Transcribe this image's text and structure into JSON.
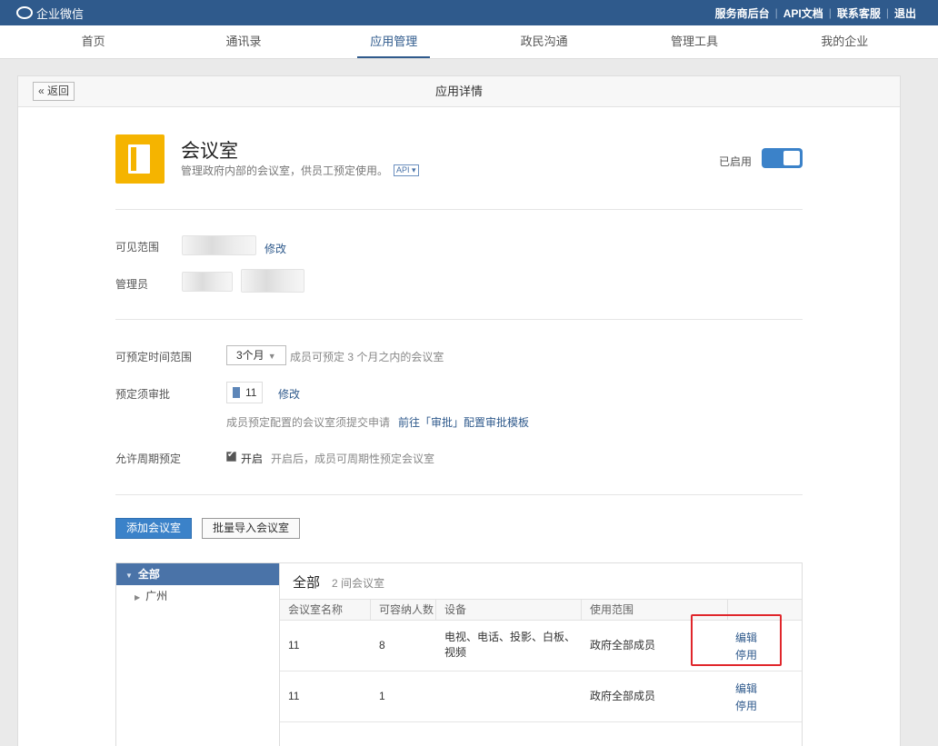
{
  "topbar": {
    "brand": "企业微信",
    "links": [
      "服务商后台",
      "API文档",
      "联系客服",
      "退出"
    ]
  },
  "nav": {
    "items": [
      "首页",
      "通讯录",
      "应用管理",
      "政民沟通",
      "管理工具",
      "我的企业"
    ],
    "active_index": 2
  },
  "card": {
    "title": "应用详情",
    "back_label": "« 返回"
  },
  "app": {
    "name": "会议室",
    "description": "管理政府内部的会议室，供员工预定使用。",
    "api_tag": "API ▾",
    "status_label": "已启用",
    "enabled": true
  },
  "visibility": {
    "label": "可见范围",
    "edit": "修改"
  },
  "admins": {
    "label": "管理员"
  },
  "booking_range": {
    "label": "可预定时间范围",
    "selected": "3个月",
    "hint": "成员可预定 3 个月之内的会议室"
  },
  "approval": {
    "label": "预定须审批",
    "approver": "11",
    "edit": "修改",
    "hint": "成员预定配置的会议室须提交申请",
    "link": "前往「审批」配置审批模板"
  },
  "recurring": {
    "label": "允许周期预定",
    "checked": true,
    "option": "开启",
    "hint": "开启后，成员可周期性预定会议室"
  },
  "actions": {
    "add": "添加会议室",
    "import": "批量导入会议室"
  },
  "tree": {
    "root": "全部",
    "children": [
      "广州"
    ]
  },
  "rooms": {
    "title": "全部",
    "count": "2 间会议室",
    "headers": [
      "会议室名称",
      "可容纳人数",
      "设备",
      "使用范围"
    ],
    "rows": [
      {
        "name": "11",
        "capacity": "8",
        "equipment_line1": "电视、电话、投影、白板、",
        "equipment_line2": "视频",
        "scope": "政府全部成员",
        "edit": "编辑",
        "disable": "停用"
      },
      {
        "name": "11",
        "capacity": "1",
        "equipment_line1": "",
        "equipment_line2": "",
        "scope": "政府全部成员",
        "edit": "编辑",
        "disable": "停用"
      }
    ]
  },
  "colors": {
    "topbar": "#2f5a8c",
    "accent": "#3b82c9",
    "app_icon": "#f5b400",
    "highlight": "#e0262b"
  }
}
